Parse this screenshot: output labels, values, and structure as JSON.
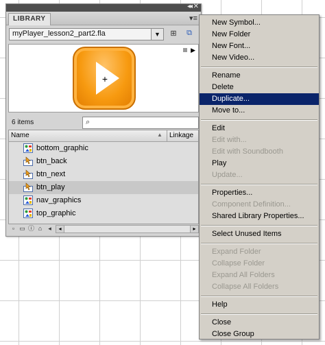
{
  "library": {
    "tab_label": "LIBRARY",
    "collapse_glyph": "◂◂",
    "close_glyph": "✕",
    "panel_menu_glyph": "▾≡",
    "file_name": "myPlayer_lesson2_part2.fla",
    "item_count": "6 items",
    "columns": {
      "name": "Name",
      "linkage": "Linkage"
    },
    "items": [
      {
        "label": "bottom_graphic",
        "kind": "graphic"
      },
      {
        "label": "btn_back",
        "kind": "button"
      },
      {
        "label": "btn_next",
        "kind": "button"
      },
      {
        "label": "btn_play",
        "kind": "button",
        "selected": true
      },
      {
        "label": "nav_graphics",
        "kind": "graphic"
      },
      {
        "label": "top_graphic",
        "kind": "graphic"
      }
    ],
    "preview_symbol": "play-button",
    "accent_orange": "#f79a10"
  },
  "menu": {
    "new_symbol": "New Symbol...",
    "new_folder": "New Folder",
    "new_font": "New Font...",
    "new_video": "New Video...",
    "rename": "Rename",
    "delete": "Delete",
    "duplicate": "Duplicate...",
    "move_to": "Move to...",
    "edit": "Edit",
    "edit_with": "Edit with...",
    "edit_with_soundbooth": "Edit with Soundbooth",
    "play": "Play",
    "update": "Update...",
    "properties": "Properties...",
    "component_definition": "Component Definition...",
    "shared_library_properties": "Shared Library Properties...",
    "select_unused_items": "Select Unused Items",
    "expand_folder": "Expand Folder",
    "collapse_folder": "Collapse Folder",
    "expand_all_folders": "Expand All Folders",
    "collapse_all_folders": "Collapse All Folders",
    "help": "Help",
    "close": "Close",
    "close_group": "Close Group",
    "highlight_color": "#0a246a"
  }
}
